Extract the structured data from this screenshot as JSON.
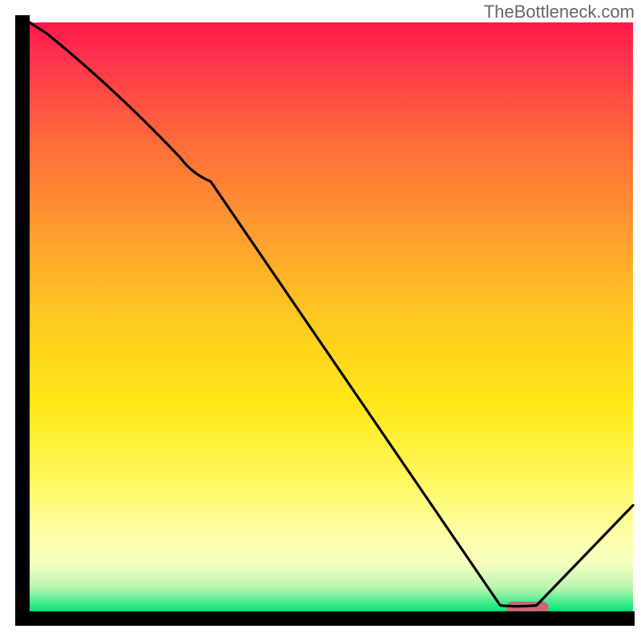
{
  "watermark": "TheBottleneck.com",
  "chart_data": {
    "type": "line",
    "title": "",
    "xlabel": "",
    "ylabel": "",
    "xlim": [
      0,
      100
    ],
    "ylim": [
      0,
      100
    ],
    "x": [
      0,
      3,
      25,
      30,
      78,
      84,
      100
    ],
    "values": [
      100,
      98,
      77,
      73,
      1,
      1,
      18
    ],
    "grid": false,
    "annotations": [],
    "marker": {
      "x_range": [
        79,
        86
      ],
      "y": 0.7,
      "color": "#CC6677"
    },
    "background_gradient": {
      "0.00": "#FF1744",
      "0.05": "#FF2E4F",
      "0.20": "#FF6A3A",
      "0.35": "#FF9A30",
      "0.50": "#FFC820",
      "0.65": "#FFE818",
      "0.78": "#FFF860",
      "0.86": "#FFFDA0",
      "0.92": "#F4FFC0",
      "0.96": "#B8F5B0",
      "1.00": "#00E676"
    },
    "axis_color": "#000000",
    "axis_width": 18
  }
}
